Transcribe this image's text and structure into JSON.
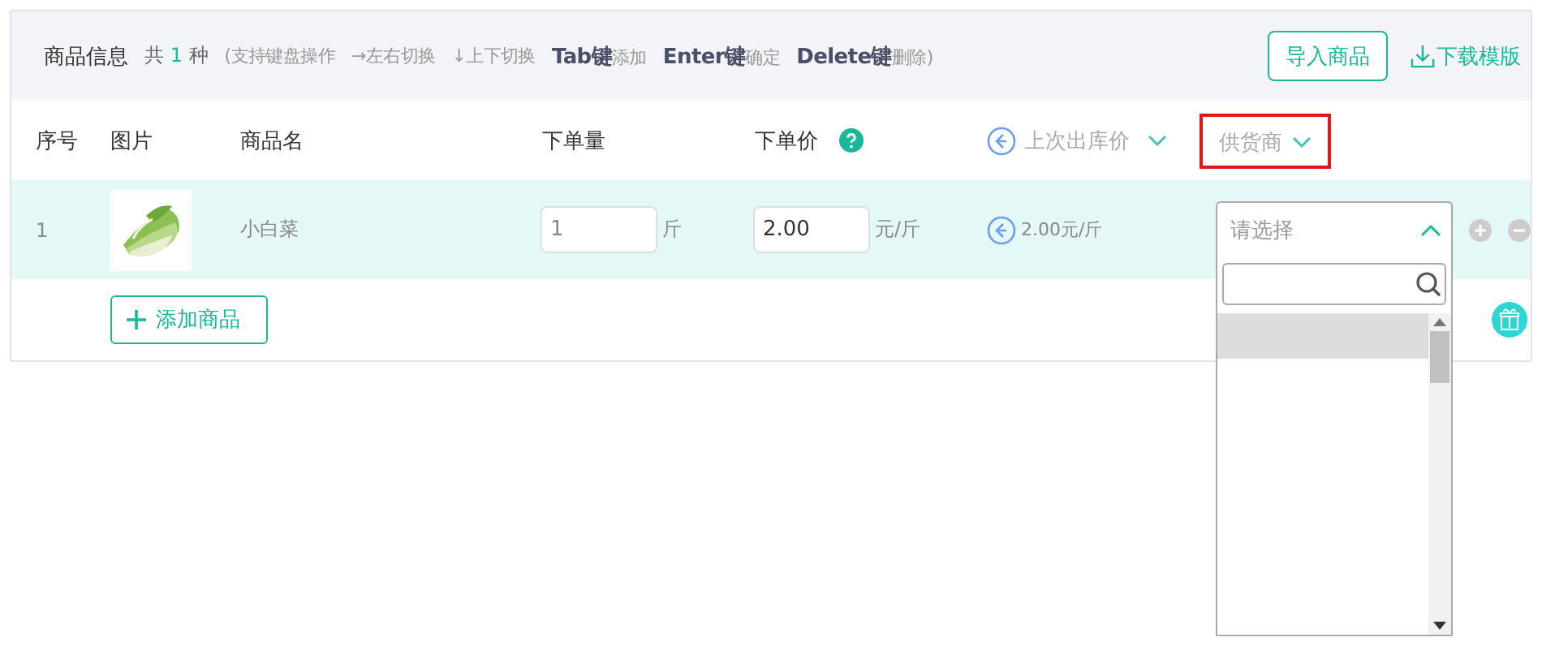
{
  "header": {
    "title": "商品信息",
    "count_prefix": "共",
    "count": "1",
    "count_suffix": "种",
    "hints": [
      {
        "kind": "plain",
        "text": "(支持键盘操作"
      },
      {
        "kind": "plain",
        "text": "→左右切换"
      },
      {
        "kind": "plain",
        "text": "↓上下切换"
      },
      {
        "kind": "key",
        "key": "Tab键",
        "text": "添加"
      },
      {
        "kind": "key",
        "key": "Enter键",
        "text": "确定"
      },
      {
        "kind": "key",
        "key": "Delete键",
        "text": "删除)"
      }
    ],
    "import_button": "导入商品",
    "download_link": "下载模版"
  },
  "columns": [
    {
      "label": "序号",
      "kind": "plain"
    },
    {
      "label": "图片",
      "kind": "plain"
    },
    {
      "label": "商品名",
      "kind": "plain"
    },
    {
      "label": "下单量",
      "kind": "plain"
    },
    {
      "label": "下单价",
      "kind": "help"
    },
    {
      "label": "上次出库价",
      "kind": "toggle"
    },
    {
      "label": "供货商",
      "kind": "dropdown",
      "highlighted": true
    }
  ],
  "rows": [
    {
      "index": "1",
      "name": "小白菜",
      "quantity": "1",
      "quantity_unit": "斤",
      "price": "2.00",
      "price_unit": "元/斤",
      "last_price": "2.00元/斤",
      "supplier": {
        "placeholder": "请选择",
        "expanded": true,
        "first_option_highlighted": true
      }
    }
  ],
  "add_button": "添加商品"
}
